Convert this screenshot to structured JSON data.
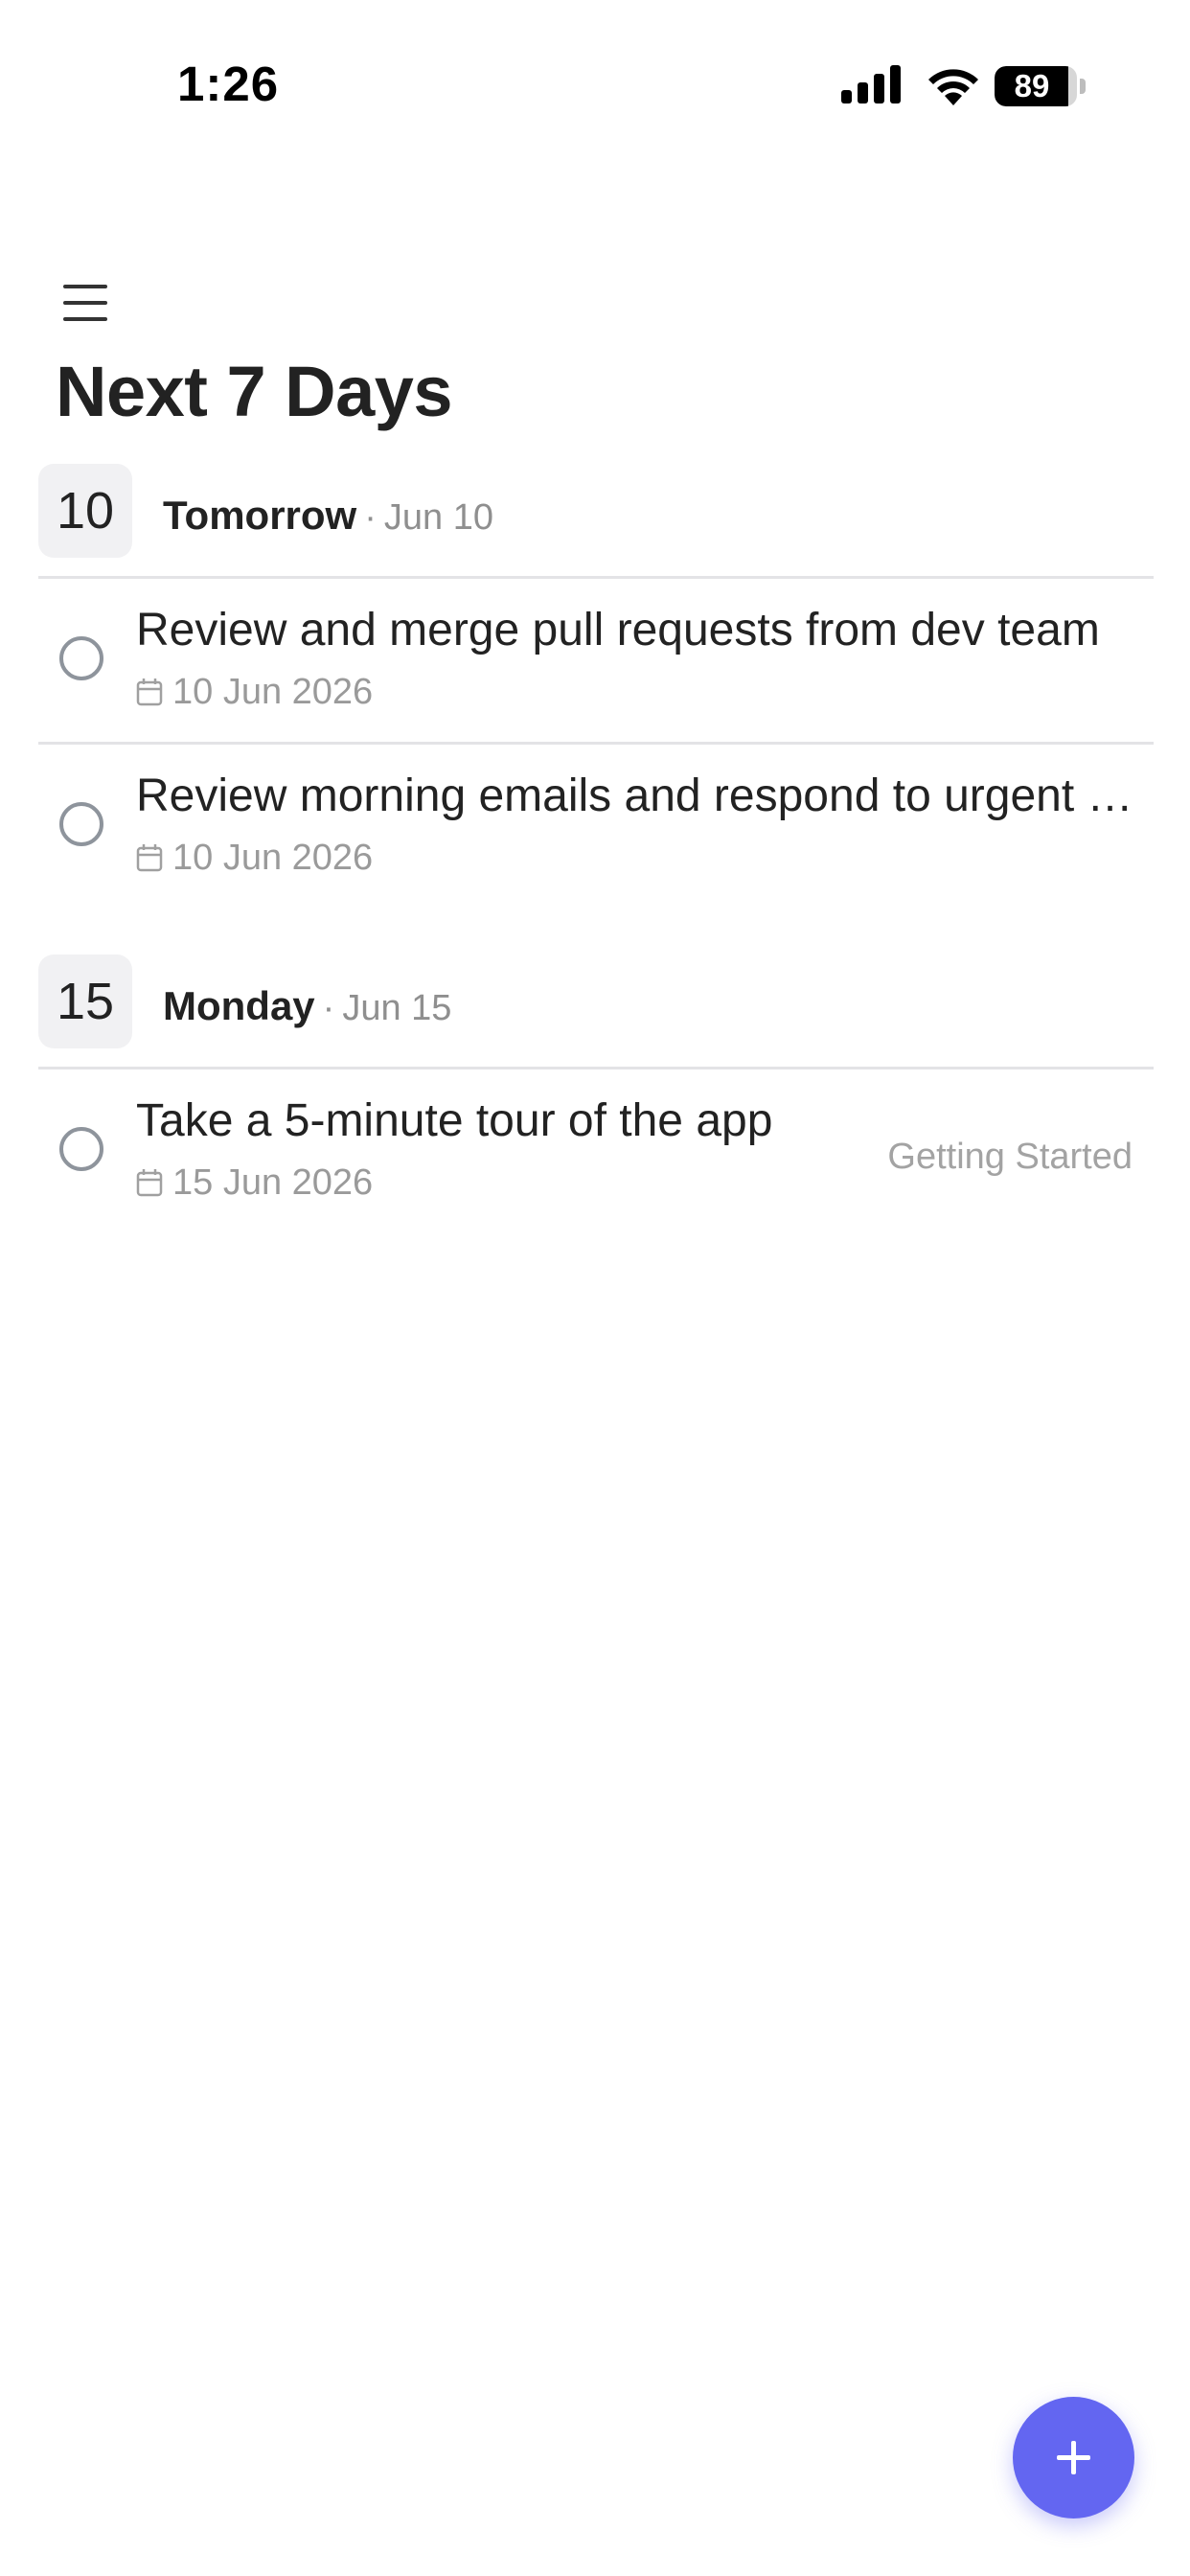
{
  "status_bar": {
    "time": "1:26",
    "battery_level": "89",
    "battery_fraction": 0.89,
    "icons": [
      "cellular-signal-icon",
      "wifi-icon",
      "battery-icon"
    ]
  },
  "header": {
    "menu_icon": "hamburger-menu-icon",
    "title": "Next 7 Days"
  },
  "sections": [
    {
      "day_number": "10",
      "day_label": "Tomorrow",
      "separator": "·",
      "date": "Jun 10",
      "tasks": [
        {
          "title": "Review and merge pull requests from dev team",
          "due": "10 Jun 2026",
          "list": ""
        },
        {
          "title": "Review morning emails and respond to urgent messages",
          "due": "10 Jun 2026",
          "list": ""
        }
      ]
    },
    {
      "day_number": "15",
      "day_label": "Monday",
      "separator": "·",
      "date": "Jun 15",
      "tasks": [
        {
          "title": "Take a 5-minute tour of the app",
          "due": "15 Jun 2026",
          "list": "Getting Started"
        }
      ]
    }
  ],
  "fab": {
    "icon": "plus-icon"
  },
  "colors": {
    "accent": "#6366f1",
    "text_primary": "#222222",
    "text_secondary": "#9a9a9a",
    "badge_background": "#f1f1f3",
    "divider": "#e3e3e6"
  }
}
